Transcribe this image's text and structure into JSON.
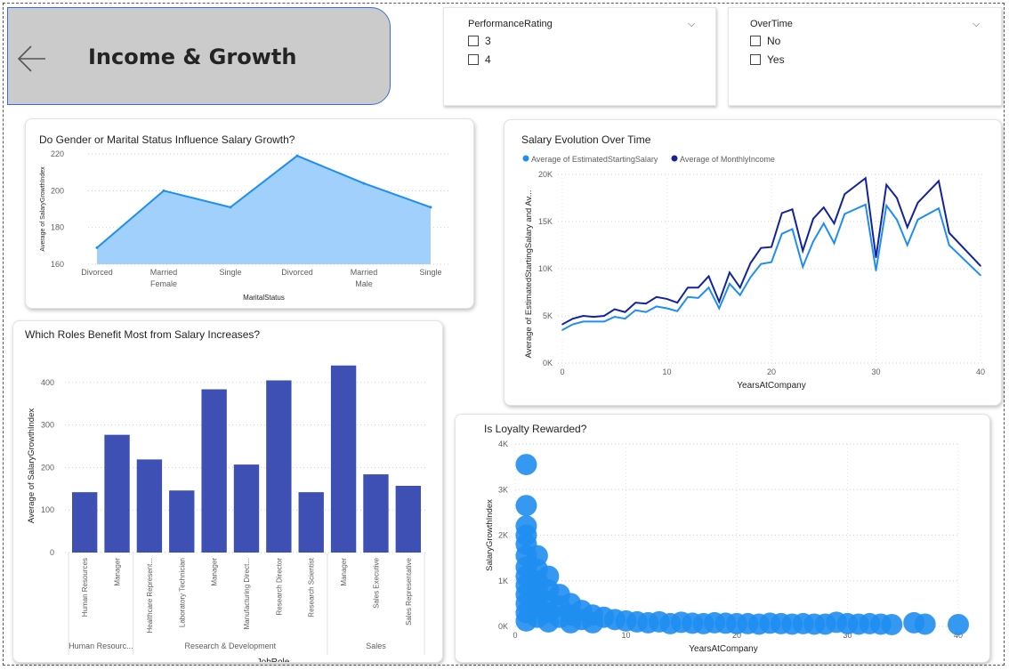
{
  "header": {
    "title": "Income & Growth",
    "back_icon": "arrow-left-icon"
  },
  "slicers": {
    "performance": {
      "title": "PerformanceRating",
      "options": [
        "3",
        "4"
      ]
    },
    "overtime": {
      "title": "OverTime",
      "options": [
        "No",
        "Yes"
      ]
    }
  },
  "colors": {
    "area": "#a0d0fb",
    "area_line": "#1f8ef1",
    "bar": "#3f50b5",
    "line_start": "#1f8ef1",
    "line_income": "#12239e",
    "scatter": "#1f8ef1"
  },
  "chart_data": [
    {
      "id": "gender-marital",
      "type": "area",
      "title": "Do Gender or Marital Status Influence Salary Growth?",
      "xlabel": "MaritalStatus",
      "ylabel": "Average of SalaryGrowthIndex",
      "categories": [
        "Divorced",
        "Married",
        "Single",
        "Divorced",
        "Married",
        "Single"
      ],
      "groups": [
        {
          "name": "Female",
          "span": [
            0,
            2
          ]
        },
        {
          "name": "Male",
          "span": [
            3,
            5
          ]
        }
      ],
      "values": [
        169,
        200,
        191,
        219,
        204,
        191
      ],
      "ylim": [
        160,
        220
      ],
      "yticks": [
        160,
        180,
        200,
        220
      ],
      "grid": true
    },
    {
      "id": "salary-evolution",
      "type": "line",
      "title": "Salary Evolution Over Time",
      "xlabel": "YearsAtCompany",
      "ylabel": "Average of EstimatedStartingSalary and Av...",
      "legend_position": "top-left",
      "xlim": [
        0,
        40
      ],
      "xticks": [
        0,
        10,
        20,
        30,
        40
      ],
      "ylim": [
        0,
        20000
      ],
      "yticks": [
        0,
        5000,
        10000,
        15000,
        20000
      ],
      "ytick_labels": [
        "0K",
        "5K",
        "10K",
        "15K",
        "20K"
      ],
      "x": [
        0,
        1,
        2,
        3,
        4,
        5,
        6,
        7,
        8,
        9,
        10,
        11,
        12,
        13,
        14,
        15,
        16,
        17,
        18,
        19,
        20,
        21,
        22,
        23,
        24,
        25,
        26,
        27,
        29,
        30,
        31,
        32,
        33,
        34,
        36,
        37,
        40
      ],
      "series": [
        {
          "name": "Average of EstimatedStartingSalary",
          "values": [
            3500,
            4100,
            4400,
            4400,
            4400,
            4900,
            4700,
            5600,
            5400,
            6000,
            5800,
            5500,
            7000,
            6900,
            8000,
            5800,
            8400,
            7200,
            9100,
            10500,
            10700,
            13700,
            14200,
            10200,
            12900,
            14800,
            12700,
            15800,
            16800,
            9800,
            16700,
            15200,
            12500,
            15200,
            16400,
            12500,
            9300
          ]
        },
        {
          "name": "Average of MonthlyIncome",
          "values": [
            4100,
            4700,
            5000,
            4900,
            5000,
            5700,
            5400,
            6400,
            6300,
            7000,
            6800,
            6400,
            8000,
            8000,
            9200,
            6500,
            9600,
            8000,
            10600,
            12200,
            12300,
            15900,
            16300,
            11900,
            15300,
            16500,
            14800,
            17900,
            19600,
            11200,
            18900,
            17500,
            14400,
            17000,
            19300,
            13800,
            10300
          ]
        }
      ]
    },
    {
      "id": "roles",
      "type": "bar",
      "title": "Which Roles Benefit Most from Salary Increases?",
      "xlabel": "JobRole",
      "ylabel": "Average of SalaryGrowthIndex",
      "categories": [
        "Human Resources",
        "Manager",
        "Healthcare Represent...",
        "Laboratory Technician",
        "Manager",
        "Manufacturing Direct...",
        "Research Director",
        "Research Scientist",
        "Manager",
        "Sales Executive",
        "Sales Representative"
      ],
      "groups": [
        {
          "name": "Human Resourc...",
          "span": [
            0,
            1
          ]
        },
        {
          "name": "Research & Development",
          "span": [
            2,
            7
          ]
        },
        {
          "name": "Sales",
          "span": [
            8,
            10
          ]
        }
      ],
      "values": [
        142,
        277,
        219,
        146,
        384,
        207,
        405,
        142,
        440,
        184,
        157
      ],
      "ylim": [
        0,
        450
      ],
      "yticks": [
        0,
        100,
        200,
        300,
        400
      ],
      "grid": true
    },
    {
      "id": "loyalty",
      "type": "scatter",
      "title": "Is Loyalty Rewarded?",
      "xlabel": "YearsAtCompany",
      "ylabel": "SalaryGrowthIndex",
      "xlim": [
        0,
        40
      ],
      "xticks": [
        0,
        10,
        20,
        30,
        40
      ],
      "ylim": [
        0,
        4000
      ],
      "yticks": [
        0,
        1000,
        2000,
        3000,
        4000
      ],
      "ytick_labels": [
        "0K",
        "1K",
        "2K",
        "3K",
        "4K"
      ],
      "points": [
        [
          1,
          3550
        ],
        [
          1,
          2650
        ],
        [
          1,
          2200
        ],
        [
          1,
          2000
        ],
        [
          1,
          1800
        ],
        [
          1,
          1550
        ],
        [
          1,
          1300
        ],
        [
          1,
          1100
        ],
        [
          1,
          900
        ],
        [
          1,
          700
        ],
        [
          1,
          500
        ],
        [
          1,
          300
        ],
        [
          1,
          120
        ],
        [
          2,
          1550
        ],
        [
          2,
          1250
        ],
        [
          2,
          1000
        ],
        [
          2,
          800
        ],
        [
          2,
          600
        ],
        [
          2,
          400
        ],
        [
          2,
          200
        ],
        [
          3,
          1100
        ],
        [
          3,
          800
        ],
        [
          3,
          550
        ],
        [
          3,
          300
        ],
        [
          3,
          100
        ],
        [
          4,
          700
        ],
        [
          4,
          450
        ],
        [
          4,
          200
        ],
        [
          5,
          500
        ],
        [
          5,
          250
        ],
        [
          5,
          80
        ],
        [
          6,
          350
        ],
        [
          6,
          150
        ],
        [
          7,
          250
        ],
        [
          7,
          80
        ],
        [
          8,
          200
        ],
        [
          9,
          150
        ],
        [
          10,
          120
        ],
        [
          11,
          100
        ],
        [
          12,
          80
        ],
        [
          13,
          100
        ],
        [
          14,
          60
        ],
        [
          15,
          90
        ],
        [
          16,
          70
        ],
        [
          17,
          60
        ],
        [
          18,
          80
        ],
        [
          19,
          70
        ],
        [
          20,
          60
        ],
        [
          21,
          60
        ],
        [
          22,
          50
        ],
        [
          23,
          70
        ],
        [
          24,
          60
        ],
        [
          25,
          50
        ],
        [
          26,
          60
        ],
        [
          27,
          50
        ],
        [
          28,
          50
        ],
        [
          29,
          90
        ],
        [
          30,
          60
        ],
        [
          31,
          50
        ],
        [
          32,
          60
        ],
        [
          33,
          50
        ],
        [
          34,
          40
        ],
        [
          36,
          80
        ],
        [
          37,
          50
        ],
        [
          40,
          40
        ]
      ]
    }
  ]
}
